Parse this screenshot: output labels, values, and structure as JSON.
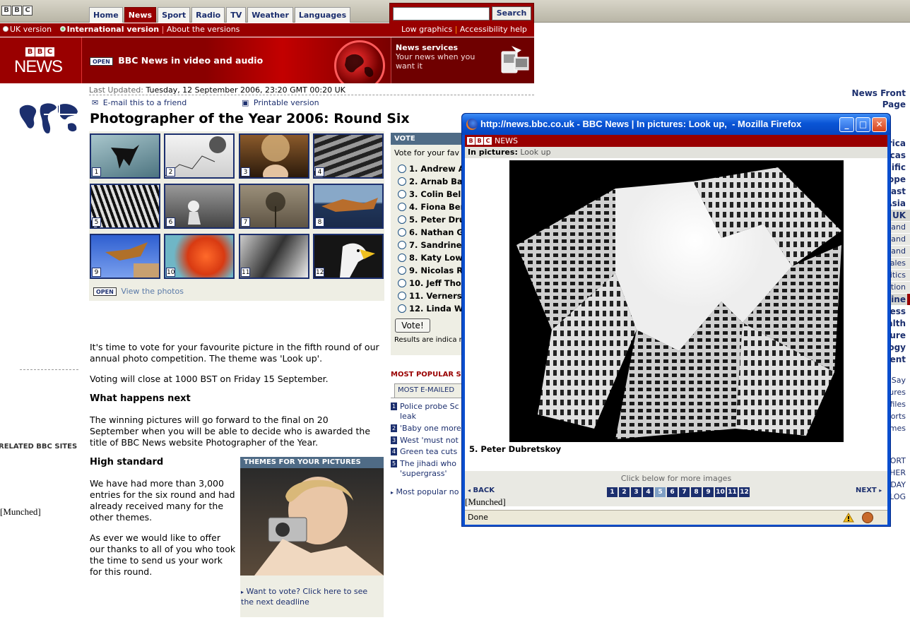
{
  "topbar": {
    "tabs": [
      "Home",
      "News",
      "Sport",
      "Radio",
      "TV",
      "Weather",
      "Languages"
    ],
    "search_button": "Search",
    "search_placeholder": ""
  },
  "versions": {
    "uk": "UK version",
    "international": "International version",
    "about": "About the versions",
    "low_graphics": "Low graphics",
    "accessibility": "Accessibility help"
  },
  "banner": {
    "logo_bbc": "BBC",
    "logo_news": "NEWS",
    "open_badge": "OPEN",
    "video_text": "BBC News in video and audio",
    "services_title": "News services",
    "services_text": "Your news when you want it"
  },
  "leftnav": {
    "items": [
      "News Front Page",
      "Africa",
      "Americas",
      "Asia-Pacific",
      "Europe",
      "Middle East",
      "South Asia",
      "UK",
      "England",
      "Northern Ireland",
      "Scotland",
      "Wales",
      "UK Politics",
      "Education",
      "Magazine",
      "Business",
      "Health",
      "Science/Nature",
      "Technology",
      "Entertainment"
    ],
    "extra": [
      "Have Your Say",
      "In Pictures",
      "Country Profiles",
      "Special Reports",
      "Programmes"
    ],
    "related_header": "RELATED BBC SITES",
    "related": [
      "SPORT",
      "WEATHER",
      "ON THIS DAY",
      "EDITORS' BLOG"
    ],
    "munched": "[Munched]"
  },
  "article": {
    "updated_label": "Last Updated:",
    "updated_value": "Tuesday, 12 September 2006, 23:20 GMT 00:20 UK",
    "email": "E-mail this to a friend",
    "printable": "Printable version",
    "title": "Photographer of the Year 2006: Round Six",
    "thumb_numbers": [
      "1",
      "2",
      "3",
      "4",
      "5",
      "6",
      "7",
      "8",
      "9",
      "10",
      "11",
      "12"
    ],
    "view_badge": "OPEN",
    "view_photos": "View the photos",
    "p1": "It's time to vote for your favourite picture in the fifth round of our annual photo competition. The theme was 'Look up'.",
    "p2": "Voting will close at 1000 BST on Friday 15 September.",
    "h_next": "What happens next",
    "p3": "The winning pictures will go forward to the final on 20 September when you will be able to decide who is awarded the title of BBC News website Photographer of the Year.",
    "h_standard": "High standard",
    "p4": "We have had more than 3,000 entries for the six round and had already received many for the other themes.",
    "p5": "As ever we would like to offer our thanks to all of you who took the time to send us your work for this round."
  },
  "themes": {
    "header": "THEMES FOR YOUR PICTURES",
    "link": "Want to vote? Click here to see the next deadline"
  },
  "vote": {
    "header": "VOTE",
    "intro": "Vote for your fav",
    "options": [
      "1. Andrew A",
      "2. Arnab Ba",
      "3. Colin Bell",
      "4. Fiona Ber",
      "5. Peter Dru",
      "6. Nathan G",
      "7. Sandrine",
      "8. Katy Low",
      "9. Nicolas R",
      "10. Jeff Tho",
      "11. Verners",
      "12. Linda W"
    ],
    "button": "Vote!",
    "results": "Results are indica reflect public opin"
  },
  "popular": {
    "header": "MOST POPULAR S",
    "tab": "MOST E-MAILED",
    "items": [
      {
        "n": "1",
        "t": "Police probe Sc leak"
      },
      {
        "n": "2",
        "t": "'Baby one more"
      },
      {
        "n": "3",
        "t": "West 'must not"
      },
      {
        "n": "4",
        "t": "Green tea cuts"
      },
      {
        "n": "5",
        "t": "The jihadi who 'supergrass'"
      }
    ],
    "more": "Most popular no"
  },
  "popup": {
    "title": "http://news.bbc.co.uk - BBC News | In pictures: Look up,  - Mozilla Firefox",
    "bbc": "BBC",
    "news": "NEWS",
    "sub_label": "In pictures:",
    "sub_value": "Look up",
    "caption": "5. Peter Dubretskoy",
    "click_below": "Click below for more images",
    "back": "BACK",
    "next": "NEXT",
    "pages": [
      "1",
      "2",
      "3",
      "4",
      "5",
      "6",
      "7",
      "8",
      "9",
      "10",
      "11",
      "12"
    ],
    "current_page": "5",
    "munched": "[Munched]",
    "status": "Done"
  },
  "colors": {
    "bbc_red": "#990000",
    "nav_blue": "#1c2f6e",
    "panel_beige": "#eeeee4",
    "xp_blue": "#0a55d6"
  }
}
